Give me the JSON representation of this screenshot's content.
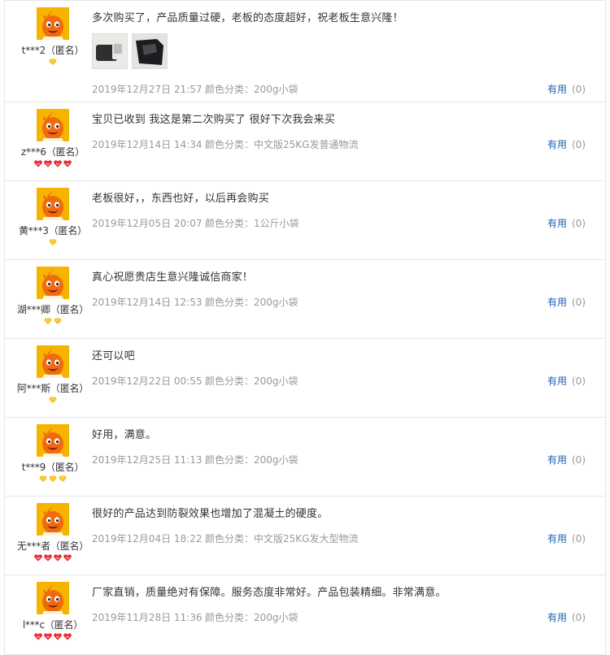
{
  "reviews": [
    {
      "user": "t***2（匿名）",
      "content": "多次购买了，产品质量过硬，老板的态度超好，祝老板生意兴隆！",
      "photos": [
        "product-photo-1",
        "product-photo-2"
      ],
      "date": "2019年12月27日 21:57",
      "category_label": "颜色分类：",
      "category_value": "200g小袋",
      "useful_label": "有用",
      "useful_count": "(0)",
      "rank_icon": "diamond-icon",
      "rank_count": 1
    },
    {
      "user": "z***6（匿名）",
      "content": "宝贝已收到 我这是第二次购买了 很好下次我会来买",
      "photos": [],
      "date": "2019年12月14日 14:34",
      "category_label": "颜色分类：",
      "category_value": "中文版25KG发普通物流",
      "useful_label": "有用",
      "useful_count": "(0)",
      "rank_icon": "heart-icon",
      "rank_count": 4
    },
    {
      "user": "黄***3（匿名）",
      "content": "老板很好，，东西也好，以后再会购买",
      "photos": [],
      "date": "2019年12月05日 20:07",
      "category_label": "颜色分类：",
      "category_value": "1公斤小袋",
      "useful_label": "有用",
      "useful_count": "(0)",
      "rank_icon": "diamond-icon",
      "rank_count": 1
    },
    {
      "user": "湖***卿（匿名）",
      "content": "真心祝愿贵店生意兴隆诚信商家！",
      "photos": [],
      "date": "2019年12月14日 12:53",
      "category_label": "颜色分类：",
      "category_value": "200g小袋",
      "useful_label": "有用",
      "useful_count": "(0)",
      "rank_icon": "diamond-icon",
      "rank_count": 2
    },
    {
      "user": "阿***斯（匿名）",
      "content": "还可以吧",
      "photos": [],
      "date": "2019年12月22日 00:55",
      "category_label": "颜色分类：",
      "category_value": "200g小袋",
      "useful_label": "有用",
      "useful_count": "(0)",
      "rank_icon": "diamond-icon",
      "rank_count": 1
    },
    {
      "user": "t***9（匿名）",
      "content": "好用，满意。",
      "photos": [],
      "date": "2019年12月25日 11:13",
      "category_label": "颜色分类：",
      "category_value": "200g小袋",
      "useful_label": "有用",
      "useful_count": "(0)",
      "rank_icon": "diamond-icon",
      "rank_count": 3
    },
    {
      "user": "无***者（匿名）",
      "content": "很好的产品达到防裂效果也增加了混凝土的硬度。",
      "photos": [],
      "date": "2019年12月04日 18:22",
      "category_label": "颜色分类：",
      "category_value": "中文版25KG发大型物流",
      "useful_label": "有用",
      "useful_count": "(0)",
      "rank_icon": "heart-icon",
      "rank_count": 4
    },
    {
      "user": "l***c（匿名）",
      "content": "厂家直销，质量绝对有保障。服务态度非常好。产品包装精细。非常满意。",
      "photos": [],
      "date": "2019年11月28日 11:36",
      "category_label": "颜色分类：",
      "category_value": "200g小袋",
      "useful_label": "有用",
      "useful_count": "(0)",
      "rank_icon": "heart-icon",
      "rank_count": 4
    }
  ],
  "colors": {
    "avatar_bg": "#f6b400",
    "avatar_face": "#f26a10",
    "diamond": "#f5b800",
    "heart": "#e8262c",
    "link": "#1b5fb4",
    "meta": "#999999"
  }
}
